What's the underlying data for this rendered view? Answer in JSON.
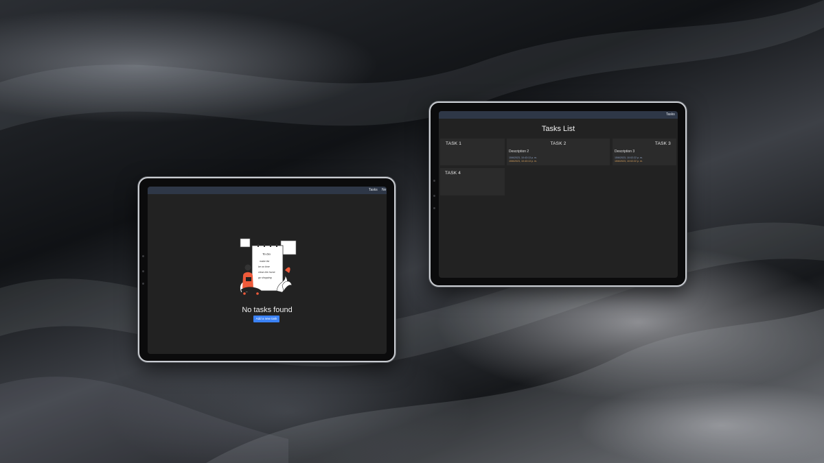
{
  "left_tablet": {
    "nav": {
      "tasks_link": "Tasks",
      "new_link": "Ne"
    },
    "empty_state": {
      "title": "No tasks found",
      "add_button": "Add a new task",
      "illustration_lines": [
        "To Do",
        "make list",
        "be on time",
        "clean the home",
        "go shopping"
      ]
    }
  },
  "right_tablet": {
    "nav": {
      "tasks_link": "Tasks"
    },
    "page_title": "Tasks List",
    "tasks": [
      {
        "title": "TASK 1",
        "description": "",
        "created": "",
        "updated": ""
      },
      {
        "title": "TASK 2",
        "description": "Description 2",
        "created": "15/6/2023, 10:43:13 p. m.",
        "updated": "15/6/2023, 10:43:13 p. m."
      },
      {
        "title": "TASK 3",
        "description": "Description 3",
        "created": "15/6/2023, 10:02:22 p. m.",
        "updated": "15/6/2023, 10:02:22 p. m."
      },
      {
        "title": "TASK 4",
        "description": "",
        "created": "",
        "updated": ""
      }
    ]
  },
  "colors": {
    "nav_bar": "#2e3747",
    "screen_bg": "#222222",
    "card_bg": "#2b2b2b",
    "button_blue": "#3b82f6",
    "date_created": "#8ea2c4",
    "date_updated": "#d9a15c"
  }
}
